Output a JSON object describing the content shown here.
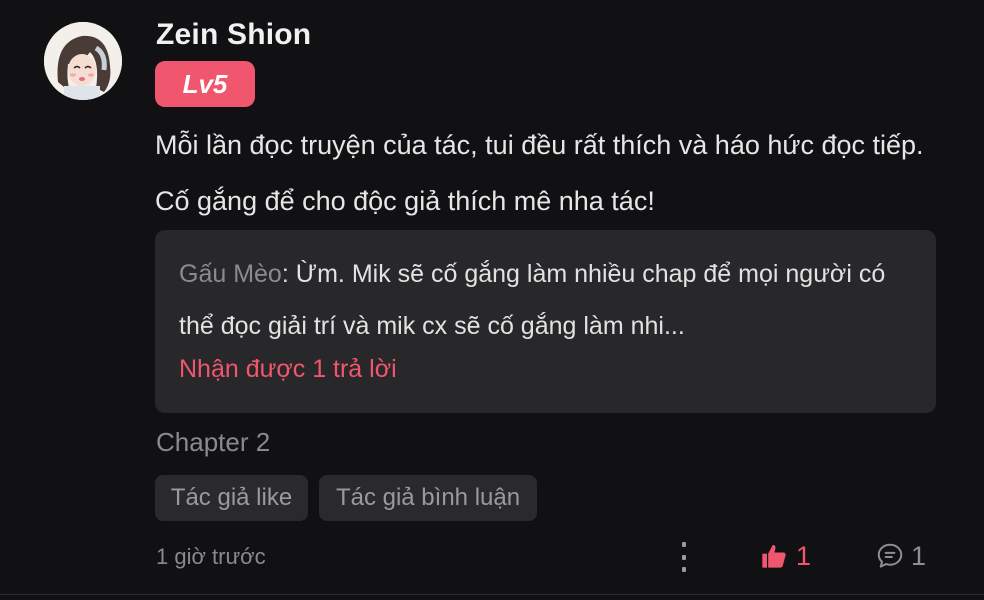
{
  "user": {
    "name": "Zein Shion",
    "level": "Lv5"
  },
  "comment": {
    "text": "Mỗi lần đọc truyện của tác, tui đều rất thích và háo hức đọc tiếp. Cố gắng để cho độc giả thích mê nha tác!"
  },
  "reply": {
    "author": "Gấu Mèo",
    "separator": ": ",
    "text": "Ừm. Mik sẽ cố gắng làm nhiều chap để mọi người có thể đọc giải trí và mik cx sẽ cố gắng làm nhi...",
    "count_label": "Nhận được 1 trả lời"
  },
  "chapter": "Chapter 2",
  "tags": [
    "Tác giả like",
    "Tác giả bình luận"
  ],
  "footer": {
    "timestamp": "1 giờ trước",
    "like_count": "1",
    "reply_count": "1"
  },
  "colors": {
    "accent": "#f0566e",
    "background": "#111113",
    "card": "#28282a"
  },
  "icons": {
    "like": "thumbs-up-icon",
    "reply": "chat-bubble-icon",
    "more": "vertical-dots-icon"
  }
}
